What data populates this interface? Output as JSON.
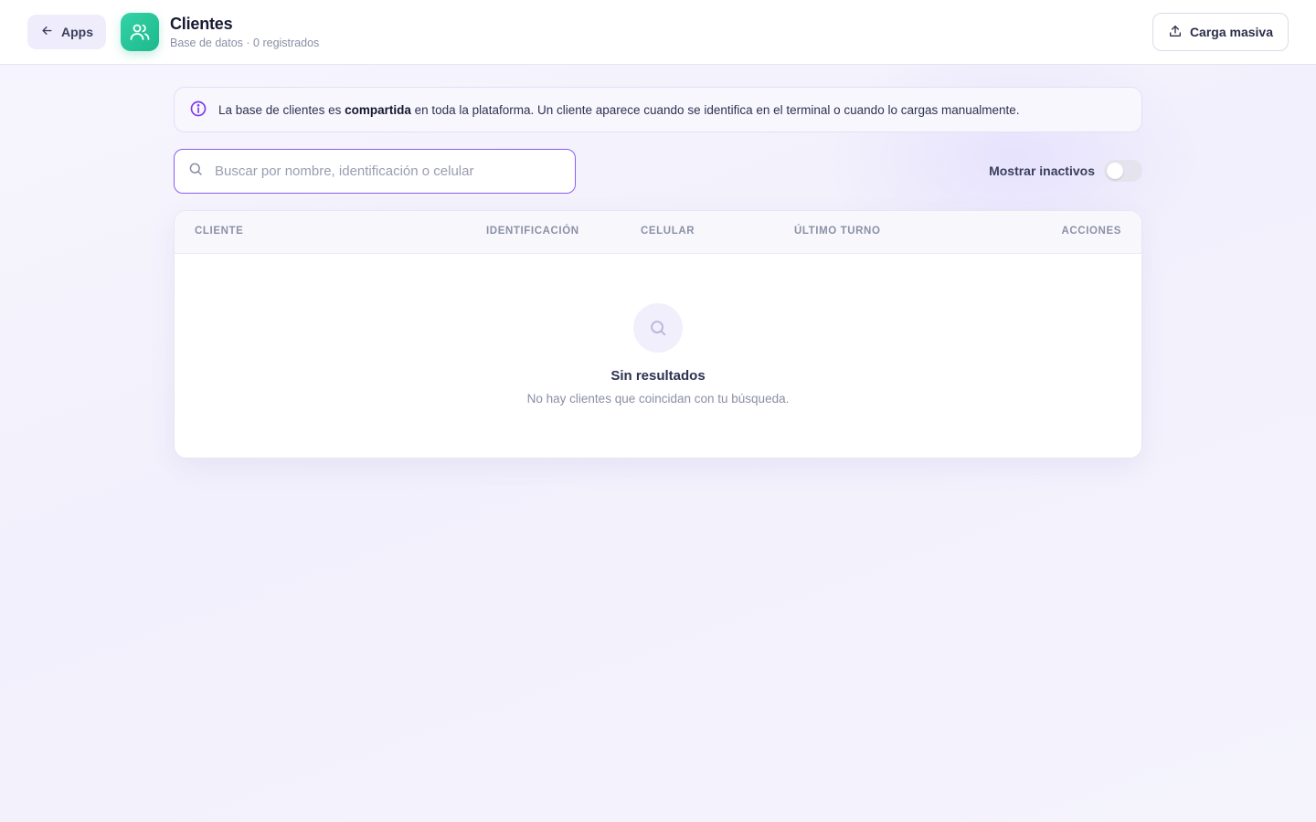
{
  "header": {
    "back_label": "Apps",
    "title": "Clientes",
    "subtitle": "Base de datos · 0 registrados",
    "upload_label": "Carga masiva"
  },
  "info": {
    "text_before": "La base de clientes es ",
    "text_bold": "compartida",
    "text_after": " en toda la plataforma. Un cliente aparece cuando se identifica en el terminal o cuando lo cargas manualmente."
  },
  "search": {
    "placeholder": "Buscar por nombre, identificación o celular",
    "value": ""
  },
  "filters": {
    "show_inactive_label": "Mostrar inactivos",
    "show_inactive": false
  },
  "table": {
    "columns": [
      "CLIENTE",
      "IDENTIFICACIÓN",
      "CELULAR",
      "ÚLTIMO TURNO",
      "ACCIONES"
    ],
    "rows": []
  },
  "empty_state": {
    "title": "Sin resultados",
    "message": "No hay clientes que coincidan con tu búsqueda."
  },
  "icons": {
    "back": "arrow-left-icon",
    "app": "users-icon",
    "upload": "upload-icon",
    "info": "info-icon",
    "search": "search-icon"
  },
  "colors": {
    "accent": "#8b5cf6",
    "app_icon": "#1bb98a"
  }
}
